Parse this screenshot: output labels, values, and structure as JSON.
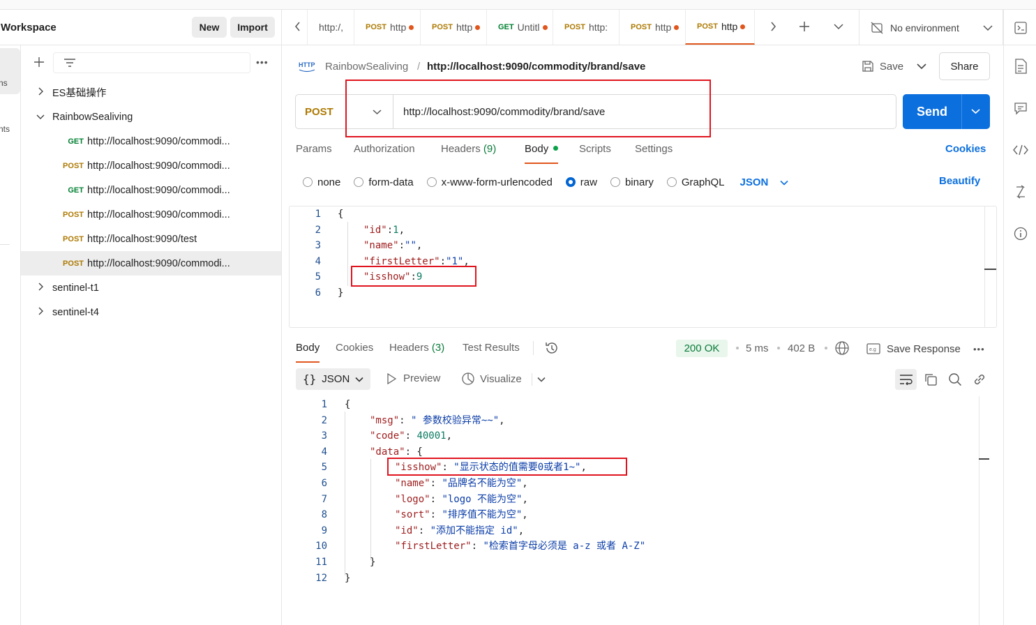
{
  "workspace": {
    "title": "Workspace",
    "new_label": "New",
    "import_label": "Import"
  },
  "left_rail": {
    "label_1": "ns",
    "label_2": "nts"
  },
  "sidebar": {
    "folders": [
      {
        "name": "ES基础操作",
        "expanded": false
      },
      {
        "name": "RainbowSealiving",
        "expanded": true
      },
      {
        "name": "sentinel-t1",
        "expanded": false
      },
      {
        "name": "sentinel-t4",
        "expanded": false
      }
    ],
    "requests": [
      {
        "method": "GET",
        "url": "http://localhost:9090/commodi..."
      },
      {
        "method": "POST",
        "url": "http://localhost:9090/commodi..."
      },
      {
        "method": "GET",
        "url": "http://localhost:9090/commodi..."
      },
      {
        "method": "POST",
        "url": "http://localhost:9090/commodi..."
      },
      {
        "method": "POST",
        "url": "http://localhost:9090/test"
      },
      {
        "method": "POST",
        "url": "http://localhost:9090/commodi..."
      }
    ]
  },
  "tabs": [
    {
      "method": "",
      "label": "http:/,"
    },
    {
      "method": "POST",
      "label": "http"
    },
    {
      "method": "POST",
      "label": "http"
    },
    {
      "method": "GET",
      "label": "Untitl"
    },
    {
      "method": "POST",
      "label": "http:"
    },
    {
      "method": "POST",
      "label": "http"
    },
    {
      "method": "POST",
      "label": "http"
    }
  ],
  "environment": {
    "label": "No environment"
  },
  "breadcrumb": {
    "collection": "RainbowSealiving",
    "separator": "/",
    "request": "http://localhost:9090/commodity/brand/save"
  },
  "actions": {
    "save": "Save",
    "share": "Share",
    "send": "Send"
  },
  "request": {
    "method": "POST",
    "url": "http://localhost:9090/commodity/brand/save"
  },
  "request_tabs": {
    "params": "Params",
    "authorization": "Authorization",
    "headers": "Headers",
    "headers_count": "(9)",
    "body": "Body",
    "scripts": "Scripts",
    "settings": "Settings",
    "cookies": "Cookies"
  },
  "body_types": {
    "none": "none",
    "form_data": "form-data",
    "urlencoded": "x-www-form-urlencoded",
    "raw": "raw",
    "binary": "binary",
    "graphql": "GraphQL",
    "format": "JSON",
    "beautify": "Beautify"
  },
  "request_body": {
    "line_numbers": [
      "1",
      "2",
      "3",
      "4",
      "5",
      "6"
    ],
    "lines": [
      [
        [
          "p",
          "{"
        ]
      ],
      [
        [
          "k",
          "\"id\""
        ],
        [
          "p",
          ":"
        ],
        [
          "n",
          "1"
        ],
        [
          "p",
          ","
        ]
      ],
      [
        [
          "k",
          "\"name\""
        ],
        [
          "p",
          ":"
        ],
        [
          "s",
          "\"\""
        ],
        [
          "p",
          ","
        ]
      ],
      [
        [
          "k",
          "\"firstLetter\""
        ],
        [
          "p",
          ":"
        ],
        [
          "s",
          "\"1\""
        ],
        [
          "p",
          ","
        ]
      ],
      [
        [
          "k",
          "\"isshow\""
        ],
        [
          "p",
          ":"
        ],
        [
          "n",
          "9"
        ]
      ],
      [
        [
          "p",
          "}"
        ]
      ]
    ]
  },
  "response_tabs": {
    "body": "Body",
    "cookies": "Cookies",
    "headers": "Headers",
    "headers_count": "(3)",
    "test_results": "Test Results"
  },
  "response_meta": {
    "status": "200 OK",
    "time": "5 ms",
    "size": "402 B",
    "save_response": "Save Response"
  },
  "response_view": {
    "format": "JSON",
    "preview": "Preview",
    "visualize": "Visualize"
  },
  "response_body": {
    "line_numbers": [
      "1",
      "2",
      "3",
      "4",
      "5",
      "6",
      "7",
      "8",
      "9",
      "10",
      "11",
      "12"
    ],
    "lines": [
      [
        [
          "p",
          "{"
        ]
      ],
      [
        [
          "k",
          "\"msg\""
        ],
        [
          "p",
          ": "
        ],
        [
          "s",
          "\" 参数校验异常~~\""
        ],
        [
          "p",
          ","
        ]
      ],
      [
        [
          "k",
          "\"code\""
        ],
        [
          "p",
          ": "
        ],
        [
          "n",
          "40001"
        ],
        [
          "p",
          ","
        ]
      ],
      [
        [
          "k",
          "\"data\""
        ],
        [
          "p",
          ": {"
        ]
      ],
      [
        [
          "k",
          "\"isshow\""
        ],
        [
          "p",
          ": "
        ],
        [
          "s",
          "\"显示状态的值需要0或者1~\""
        ],
        [
          "p",
          ","
        ]
      ],
      [
        [
          "k",
          "\"name\""
        ],
        [
          "p",
          ": "
        ],
        [
          "s",
          "\"品牌名不能为空\""
        ],
        [
          "p",
          ","
        ]
      ],
      [
        [
          "k",
          "\"logo\""
        ],
        [
          "p",
          ": "
        ],
        [
          "s",
          "\"logo 不能为空\""
        ],
        [
          "p",
          ","
        ]
      ],
      [
        [
          "k",
          "\"sort\""
        ],
        [
          "p",
          ": "
        ],
        [
          "s",
          "\"排序值不能为空\""
        ],
        [
          "p",
          ","
        ]
      ],
      [
        [
          "k",
          "\"id\""
        ],
        [
          "p",
          ": "
        ],
        [
          "s",
          "\"添加不能指定 id\""
        ],
        [
          "p",
          ","
        ]
      ],
      [
        [
          "k",
          "\"firstLetter\""
        ],
        [
          "p",
          ": "
        ],
        [
          "s",
          "\"检索首字母必须是 a-z 或者 A-Z\""
        ]
      ],
      [
        [
          "p",
          "}"
        ]
      ],
      [
        [
          "p",
          "}"
        ]
      ]
    ]
  }
}
